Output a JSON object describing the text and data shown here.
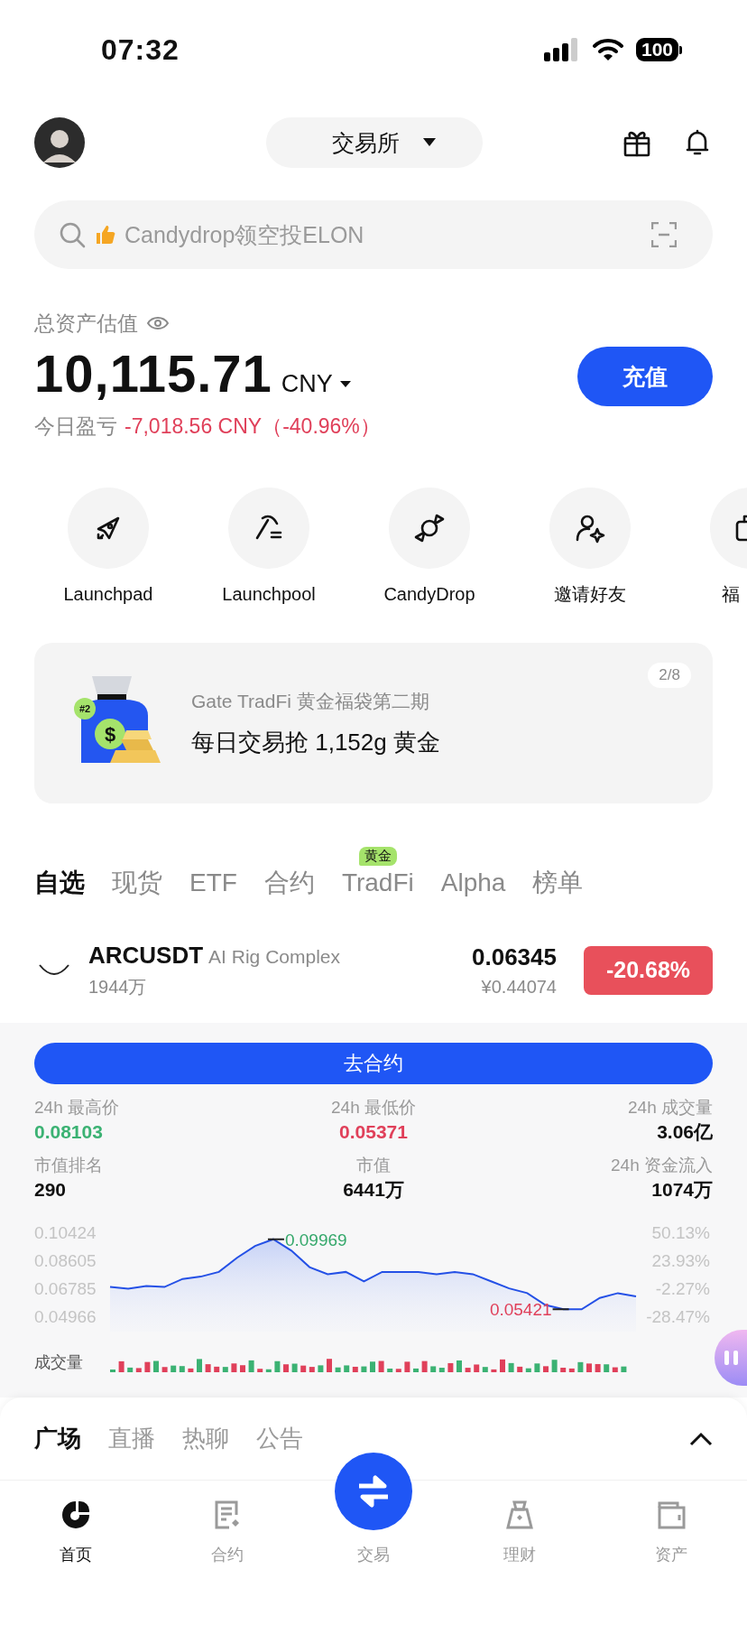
{
  "status_bar": {
    "time": "07:32",
    "battery": "100"
  },
  "header": {
    "exchange_selector": "交易所"
  },
  "search": {
    "placeholder": "Candydrop领空投ELON"
  },
  "assets": {
    "label": "总资产估值",
    "amount": "10,115.71",
    "currency": "CNY",
    "pnl_label": "今日盈亏",
    "pnl_value": "-7,018.56 CNY（-40.96%）",
    "deposit_button": "充值"
  },
  "quick_actions": [
    {
      "label": "Launchpad",
      "kind": "rocket"
    },
    {
      "label": "Launchpool",
      "kind": "pickaxe"
    },
    {
      "label": "CandyDrop",
      "kind": "candy"
    },
    {
      "label": "邀请好友",
      "kind": "invite"
    },
    {
      "label": "福",
      "kind": "bag"
    }
  ],
  "banner": {
    "badge": "#2",
    "coin_symbol": "$",
    "subtitle": "Gate TradFi 黄金福袋第二期",
    "title": "每日交易抢 1,152g 黄金",
    "pager": "2/8"
  },
  "market_tabs": [
    {
      "label": "自选",
      "selected": true
    },
    {
      "label": "现货",
      "selected": false
    },
    {
      "label": "ETF",
      "selected": false
    },
    {
      "label": "合约",
      "selected": false
    },
    {
      "label": "TradFi",
      "selected": false,
      "badge": "黄金"
    },
    {
      "label": "Alpha",
      "selected": false
    },
    {
      "label": "榜单",
      "selected": false
    }
  ],
  "watchlist": [
    {
      "symbol": "ARCUSDT",
      "name": "AI Rig Complex",
      "volume": "1944万",
      "price": "0.06345",
      "price_cny": "¥0.44074",
      "change": "-20.68%",
      "color": "#e8505b",
      "expanded": true
    }
  ],
  "detail": {
    "futures_button": "去合约",
    "stats": [
      {
        "label": "24h 最高价",
        "value": "0.08103",
        "color": "#3bb273"
      },
      {
        "label": "24h 最低价",
        "value": "0.05371",
        "color": "#e0405a"
      },
      {
        "label": "24h 成交量",
        "value": "3.06亿",
        "color": "#111111"
      },
      {
        "label": "市值排名",
        "value": "290",
        "color": "#111111"
      },
      {
        "label": "市值",
        "value": "6441万",
        "color": "#111111"
      },
      {
        "label": "24h 资金流入",
        "value": "1074万",
        "color": "#111111"
      }
    ],
    "price_chart": {
      "chart_data": {
        "type": "area",
        "ylim": [
          0.04966,
          0.10424
        ],
        "yticks": [
          {
            "value": 0.10424,
            "label": "0.10424"
          },
          {
            "value": 0.08605,
            "label": "0.08605"
          },
          {
            "value": 0.06785,
            "label": "0.06785"
          },
          {
            "value": 0.04966,
            "label": "0.04966"
          }
        ],
        "series": [
          {
            "color": "#2450e6",
            "values": [
              0.0687,
              0.0675,
              0.0693,
              0.0687,
              0.0739,
              0.0754,
              0.0785,
              0.0877,
              0.0954,
              0.0997,
              0.0923,
              0.0816,
              0.077,
              0.0785,
              0.0724,
              0.0785,
              0.0785,
              0.0785,
              0.077,
              0.0785,
              0.077,
              0.0724,
              0.0678,
              0.0647,
              0.057,
              0.0542,
              0.0542,
              0.0616,
              0.0647,
              0.0625
            ]
          }
        ],
        "annotations": [
          "0.09969",
          "0.05421"
        ]
      },
      "right_ticks": [
        "50.13%",
        "23.93%",
        "-2.27%",
        "-28.47%"
      ]
    },
    "volume_label": "成交量"
  },
  "feed_tabs": [
    {
      "label": "广场",
      "selected": true
    },
    {
      "label": "直播",
      "selected": false
    },
    {
      "label": "热聊",
      "selected": false
    },
    {
      "label": "公告",
      "selected": false
    }
  ],
  "nav": [
    {
      "label": "首页",
      "selected": true,
      "kind": "home"
    },
    {
      "label": "合约",
      "selected": false,
      "kind": "futures"
    },
    {
      "label": "交易",
      "selected": false,
      "kind": "trade"
    },
    {
      "label": "理财",
      "selected": false,
      "kind": "earn"
    },
    {
      "label": "资产",
      "selected": false,
      "kind": "wallet"
    }
  ]
}
